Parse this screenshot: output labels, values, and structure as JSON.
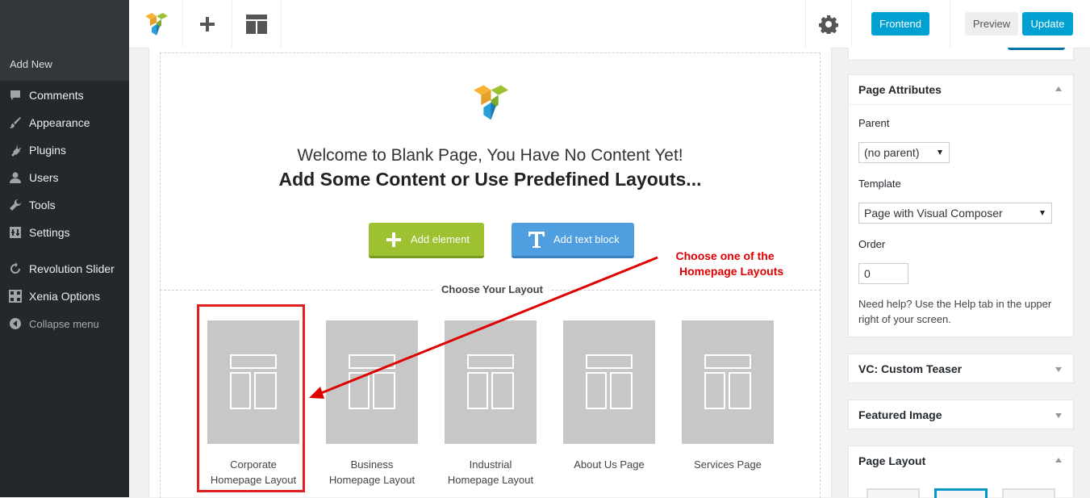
{
  "sidebar": {
    "submenu_item": "Add New",
    "items": [
      {
        "label": "Comments",
        "icon": "comment-icon"
      },
      {
        "label": "Appearance",
        "icon": "brush-icon"
      },
      {
        "label": "Plugins",
        "icon": "plug-icon"
      },
      {
        "label": "Users",
        "icon": "user-icon"
      },
      {
        "label": "Tools",
        "icon": "wrench-icon"
      },
      {
        "label": "Settings",
        "icon": "settings-icon"
      },
      {
        "label": "Revolution Slider",
        "icon": "refresh-icon"
      },
      {
        "label": "Xenia Options",
        "icon": "grid-icon"
      }
    ],
    "collapse_label": "Collapse menu"
  },
  "toolbar": {
    "frontend_label": "Frontend",
    "preview_label": "Preview",
    "update_label": "Update"
  },
  "editor": {
    "welcome_line1": "Welcome to Blank Page, You Have No Content Yet!",
    "welcome_line2": "Add Some Content or Use Predefined Layouts...",
    "add_element_label": "Add element",
    "add_text_block_label": "Add text block",
    "choose_layout_title": "Choose Your Layout",
    "layouts": [
      {
        "line1": "Corporate",
        "line2": "Homepage Layout"
      },
      {
        "line1": "Business",
        "line2": "Homepage Layout"
      },
      {
        "line1": "Industrial",
        "line2": "Homepage Layout"
      },
      {
        "line1": "About Us Page",
        "line2": ""
      },
      {
        "line1": "Services Page",
        "line2": ""
      }
    ],
    "annotation_line1": "Choose one of the",
    "annotation_line2": "Homepage Layouts"
  },
  "right_panel": {
    "page_attributes": {
      "title": "Page Attributes",
      "parent_label": "Parent",
      "parent_value": "(no parent)",
      "template_label": "Template",
      "template_value": "Page with Visual Composer",
      "order_label": "Order",
      "order_value": "0",
      "help_text": "Need help? Use the Help tab in the upper right of your screen."
    },
    "vc_custom_teaser": {
      "title": "VC: Custom Teaser"
    },
    "featured_image": {
      "title": "Featured Image"
    },
    "page_layout": {
      "title": "Page Layout"
    }
  },
  "colors": {
    "accent_blue": "#00a0d2",
    "add_element_green": "#9ec132",
    "add_text_blue": "#4f9fe0",
    "annotation_red": "#e00000"
  }
}
